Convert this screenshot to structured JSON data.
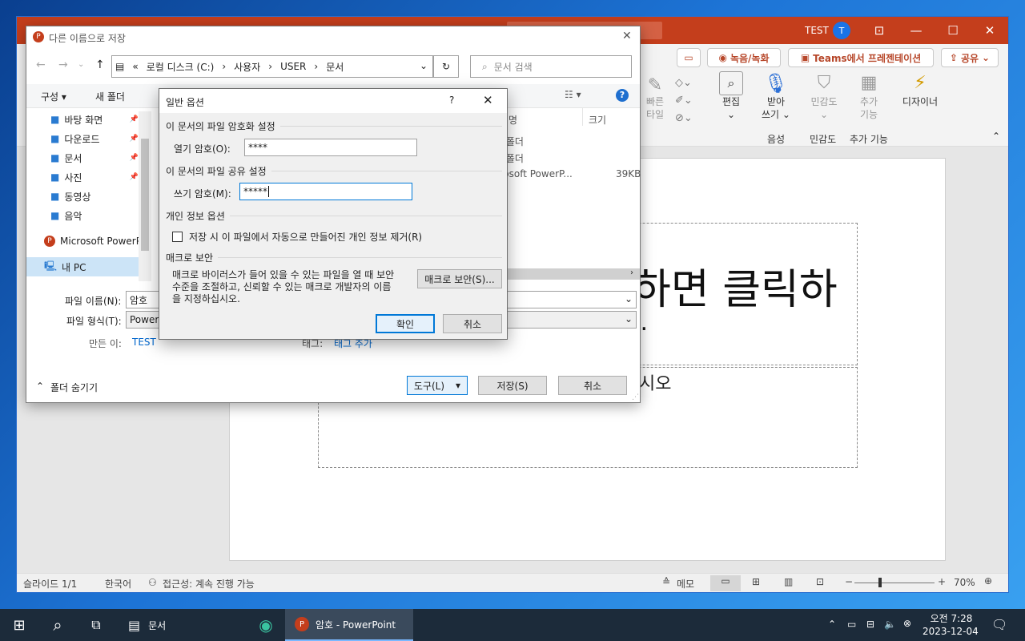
{
  "colors": {
    "ppt_accent": "#c43e1c",
    "taskbar": "#1c2b3a",
    "link": "#0066cc"
  },
  "ppt": {
    "user_label": "TEST",
    "avatar_letter": "T",
    "ribbon_buttons": {
      "comment": "",
      "record": "녹음/녹화",
      "teams": "Teams에서 프레젠테이션",
      "share": "공유"
    },
    "groups": {
      "edit": "편집",
      "dictate_line1": "받아",
      "dictate_line2": "쓰기",
      "sensitivity": "민감도",
      "addins_line1": "추가",
      "addins_line2": "기능",
      "designer": "디자이너",
      "quick_styles_line1": "빠른",
      "quick_styles_line2": "타일",
      "voice_group": "음성",
      "sensitivity_group": "민감도",
      "addins_group": "추가 기능"
    },
    "slide": {
      "title_fragment": "하면 클릭하",
      "title_dots": "..",
      "subtitle_fragment": "시오"
    },
    "status": {
      "slide": "슬라이드 1/1",
      "language": "한국어",
      "accessibility": "접근성: 계속 진행 가능",
      "notes": "메모",
      "zoom": "70%"
    }
  },
  "saveas": {
    "title": "다른 이름으로 저장",
    "breadcrumb": {
      "prefix": "«",
      "parts": [
        "로컬 디스크 (C:)",
        "사용자",
        "USER",
        "문서"
      ]
    },
    "search_placeholder": "문서 검색",
    "toolbar": {
      "organize": "구성",
      "new_folder": "새 폴더"
    },
    "nav_items": [
      {
        "label": "바탕 화면",
        "icon": "desktop-icon",
        "pinned": true
      },
      {
        "label": "다운로드",
        "icon": "download-icon",
        "pinned": true
      },
      {
        "label": "문서",
        "icon": "document-icon",
        "pinned": true
      },
      {
        "label": "사진",
        "icon": "pictures-icon",
        "pinned": true
      },
      {
        "label": "동영상",
        "icon": "video-icon",
        "pinned": false
      },
      {
        "label": "음악",
        "icon": "music-icon",
        "pinned": false
      }
    ],
    "nav_powerpoint": "Microsoft PowerP",
    "nav_pc": "내 PC",
    "columns": {
      "size": "크기"
    },
    "files": [
      {
        "name": "일 폴더",
        "size": ""
      },
      {
        "name": "일 폴더",
        "size": ""
      },
      {
        "name": "crosoft PowerP...",
        "size": "39KB"
      }
    ],
    "filename_label": "파일 이름(N):",
    "filename_value": "암호",
    "filetype_label": "파일 형식(T):",
    "filetype_value": "PowerP",
    "author_label": "만든 이:",
    "author_value": "TEST",
    "tags_label": "태그:",
    "tags_value": "태그 추가",
    "hide_folders": "폴더 숨기기",
    "tools": "도구(L)",
    "save": "저장(S)",
    "cancel": "취소"
  },
  "options": {
    "title": "일반 옵션",
    "help": "?",
    "encrypt_section": "이 문서의 파일 암호화 설정",
    "open_pw_label": "열기 암호(O):",
    "open_pw_value": "****",
    "share_section": "이 문서의 파일 공유 설정",
    "modify_pw_label": "쓰기 암호(M):",
    "modify_pw_value": "*****",
    "privacy_section": "개인 정보 옵션",
    "privacy_checkbox": "저장 시 이 파일에서 자동으로 만들어진 개인 정보 제거(R)",
    "macro_section": "매크로 보안",
    "macro_text": "매크로 바이러스가 들어 있을 수 있는 파일을 열 때 보안 수준을 조절하고, 신뢰할 수 있는 매크로 개발자의 이름을 지정하십시오.",
    "macro_button": "매크로 보안(S)...",
    "ok": "확인",
    "cancel": "취소"
  },
  "taskbar": {
    "explorer_label": "문서",
    "ppt_label": "암호 - PowerPoint",
    "time": "오전 7:28",
    "date": "2023-12-04"
  }
}
